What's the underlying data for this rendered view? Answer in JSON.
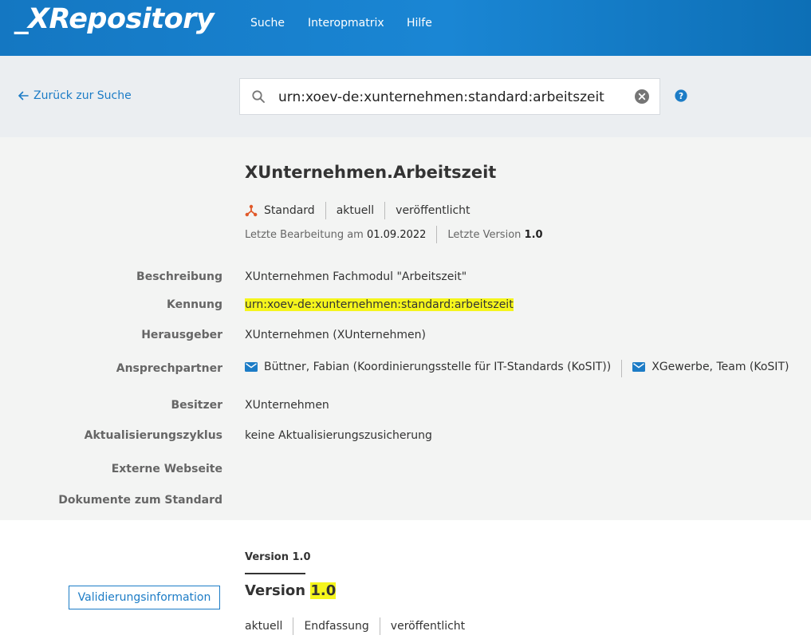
{
  "header": {
    "logo": "_XRepository",
    "nav": [
      "Suche",
      "Interopmatrix",
      "Hilfe"
    ]
  },
  "searchbar": {
    "back_label": "Zurück zur Suche",
    "query": "urn:xoev-de:xunternehmen:standard:arbeitszeit"
  },
  "detail": {
    "title": "XUnternehmen.Arbeitszeit",
    "type": "Standard",
    "state": "aktuell",
    "publication": "veröffentlicht",
    "last_edit_label": "Letzte Bearbeitung am",
    "last_edit_date": "01.09.2022",
    "last_version_label": "Letzte Version",
    "last_version": "1.0",
    "fields": {
      "beschreibung_label": "Beschreibung",
      "beschreibung": "XUnternehmen Fachmodul \"Arbeitszeit\"",
      "kennung_label": "Kennung",
      "kennung": "urn:xoev-de:xunternehmen:standard:arbeitszeit",
      "herausgeber_label": "Herausgeber",
      "herausgeber": "XUnternehmen (XUnternehmen)",
      "ansprechpartner_label": "Ansprechpartner",
      "ansprechpartner": [
        "Büttner, Fabian (Koordinierungsstelle für IT-Standards (KoSIT))",
        "XGewerbe, Team (KoSIT)"
      ],
      "besitzer_label": "Besitzer",
      "besitzer": "XUnternehmen",
      "zyklus_label": "Aktualisierungszyklus",
      "zyklus": "keine Aktualisierungszusicherung",
      "webseite_label": "Externe Webseite",
      "dokumente_label": "Dokumente zum Standard"
    }
  },
  "version_section": {
    "tab_label": "Version 1.0",
    "validation_button": "Validierungsinformation",
    "title_prefix": "Version",
    "title_number": "1.0",
    "state": "aktuell",
    "stage": "Endfassung",
    "publication": "veröffentlicht"
  },
  "colors": {
    "header_blue": "#1a86d4",
    "link_blue": "#1c7cc6",
    "highlight": "#f5f51c",
    "standard_icon": "#e0592a"
  }
}
